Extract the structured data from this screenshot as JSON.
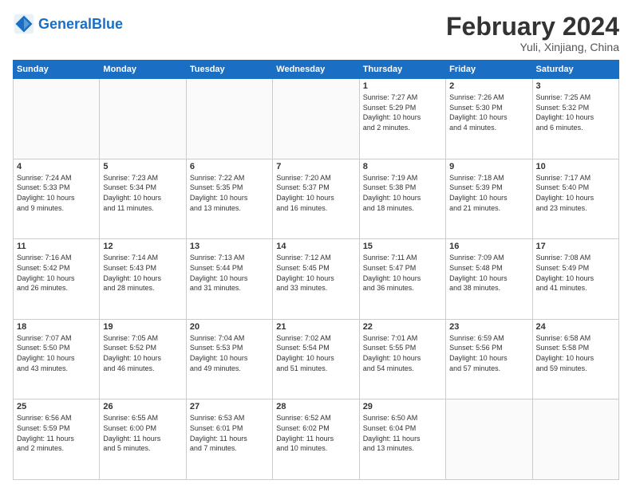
{
  "logo": {
    "text_general": "General",
    "text_blue": "Blue"
  },
  "header": {
    "month_year": "February 2024",
    "location": "Yuli, Xinjiang, China"
  },
  "weekdays": [
    "Sunday",
    "Monday",
    "Tuesday",
    "Wednesday",
    "Thursday",
    "Friday",
    "Saturday"
  ],
  "weeks": [
    [
      {
        "day": "",
        "info": ""
      },
      {
        "day": "",
        "info": ""
      },
      {
        "day": "",
        "info": ""
      },
      {
        "day": "",
        "info": ""
      },
      {
        "day": "1",
        "info": "Sunrise: 7:27 AM\nSunset: 5:29 PM\nDaylight: 10 hours\nand 2 minutes."
      },
      {
        "day": "2",
        "info": "Sunrise: 7:26 AM\nSunset: 5:30 PM\nDaylight: 10 hours\nand 4 minutes."
      },
      {
        "day": "3",
        "info": "Sunrise: 7:25 AM\nSunset: 5:32 PM\nDaylight: 10 hours\nand 6 minutes."
      }
    ],
    [
      {
        "day": "4",
        "info": "Sunrise: 7:24 AM\nSunset: 5:33 PM\nDaylight: 10 hours\nand 9 minutes."
      },
      {
        "day": "5",
        "info": "Sunrise: 7:23 AM\nSunset: 5:34 PM\nDaylight: 10 hours\nand 11 minutes."
      },
      {
        "day": "6",
        "info": "Sunrise: 7:22 AM\nSunset: 5:35 PM\nDaylight: 10 hours\nand 13 minutes."
      },
      {
        "day": "7",
        "info": "Sunrise: 7:20 AM\nSunset: 5:37 PM\nDaylight: 10 hours\nand 16 minutes."
      },
      {
        "day": "8",
        "info": "Sunrise: 7:19 AM\nSunset: 5:38 PM\nDaylight: 10 hours\nand 18 minutes."
      },
      {
        "day": "9",
        "info": "Sunrise: 7:18 AM\nSunset: 5:39 PM\nDaylight: 10 hours\nand 21 minutes."
      },
      {
        "day": "10",
        "info": "Sunrise: 7:17 AM\nSunset: 5:40 PM\nDaylight: 10 hours\nand 23 minutes."
      }
    ],
    [
      {
        "day": "11",
        "info": "Sunrise: 7:16 AM\nSunset: 5:42 PM\nDaylight: 10 hours\nand 26 minutes."
      },
      {
        "day": "12",
        "info": "Sunrise: 7:14 AM\nSunset: 5:43 PM\nDaylight: 10 hours\nand 28 minutes."
      },
      {
        "day": "13",
        "info": "Sunrise: 7:13 AM\nSunset: 5:44 PM\nDaylight: 10 hours\nand 31 minutes."
      },
      {
        "day": "14",
        "info": "Sunrise: 7:12 AM\nSunset: 5:45 PM\nDaylight: 10 hours\nand 33 minutes."
      },
      {
        "day": "15",
        "info": "Sunrise: 7:11 AM\nSunset: 5:47 PM\nDaylight: 10 hours\nand 36 minutes."
      },
      {
        "day": "16",
        "info": "Sunrise: 7:09 AM\nSunset: 5:48 PM\nDaylight: 10 hours\nand 38 minutes."
      },
      {
        "day": "17",
        "info": "Sunrise: 7:08 AM\nSunset: 5:49 PM\nDaylight: 10 hours\nand 41 minutes."
      }
    ],
    [
      {
        "day": "18",
        "info": "Sunrise: 7:07 AM\nSunset: 5:50 PM\nDaylight: 10 hours\nand 43 minutes."
      },
      {
        "day": "19",
        "info": "Sunrise: 7:05 AM\nSunset: 5:52 PM\nDaylight: 10 hours\nand 46 minutes."
      },
      {
        "day": "20",
        "info": "Sunrise: 7:04 AM\nSunset: 5:53 PM\nDaylight: 10 hours\nand 49 minutes."
      },
      {
        "day": "21",
        "info": "Sunrise: 7:02 AM\nSunset: 5:54 PM\nDaylight: 10 hours\nand 51 minutes."
      },
      {
        "day": "22",
        "info": "Sunrise: 7:01 AM\nSunset: 5:55 PM\nDaylight: 10 hours\nand 54 minutes."
      },
      {
        "day": "23",
        "info": "Sunrise: 6:59 AM\nSunset: 5:56 PM\nDaylight: 10 hours\nand 57 minutes."
      },
      {
        "day": "24",
        "info": "Sunrise: 6:58 AM\nSunset: 5:58 PM\nDaylight: 10 hours\nand 59 minutes."
      }
    ],
    [
      {
        "day": "25",
        "info": "Sunrise: 6:56 AM\nSunset: 5:59 PM\nDaylight: 11 hours\nand 2 minutes."
      },
      {
        "day": "26",
        "info": "Sunrise: 6:55 AM\nSunset: 6:00 PM\nDaylight: 11 hours\nand 5 minutes."
      },
      {
        "day": "27",
        "info": "Sunrise: 6:53 AM\nSunset: 6:01 PM\nDaylight: 11 hours\nand 7 minutes."
      },
      {
        "day": "28",
        "info": "Sunrise: 6:52 AM\nSunset: 6:02 PM\nDaylight: 11 hours\nand 10 minutes."
      },
      {
        "day": "29",
        "info": "Sunrise: 6:50 AM\nSunset: 6:04 PM\nDaylight: 11 hours\nand 13 minutes."
      },
      {
        "day": "",
        "info": ""
      },
      {
        "day": "",
        "info": ""
      }
    ]
  ]
}
